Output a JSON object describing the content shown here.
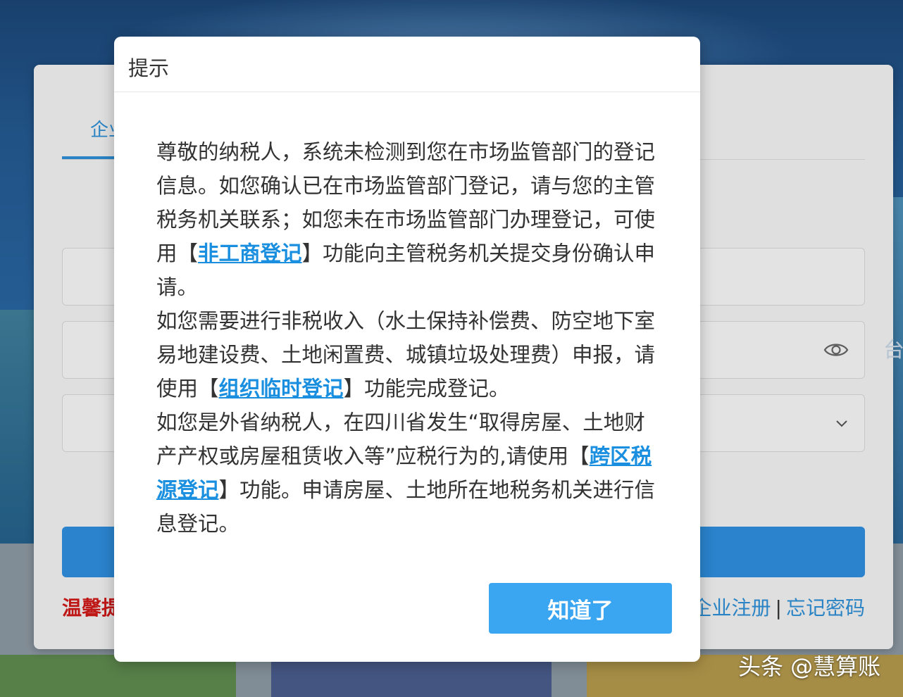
{
  "background": {
    "tab_label_fragment": "企业",
    "warm_tip_label": "温馨提",
    "links": [
      "企业注册",
      "忘记密码"
    ],
    "link_separator": "|",
    "edge_fragment": "台",
    "icons": {
      "password_toggle": "eye-icon",
      "select_arrow": "chevron-down-icon"
    },
    "colors": {
      "accent": "#2e8fde",
      "tip": "#d01818"
    }
  },
  "dialog": {
    "title": "提示",
    "p1": {
      "before": "尊敬的纳税人，系统未检测到您在市场监管部门的登记信息。如您确认已在市场监管部门登记，请与您的主管税务机关联系；如您未在市场监管部门办理登记，可使用【",
      "link": "非工商登记",
      "after": "】功能向主管税务机关提交身份确认申请。"
    },
    "p2": {
      "before": "如您需要进行非税收入（水土保持补偿费、防空地下室易地建设费、土地闲置费、城镇垃圾处理费）申报，请使用【",
      "link": "组织临时登记",
      "after": "】功能完成登记。"
    },
    "p3": {
      "before": "如您是外省纳税人，在四川省发生“取得房屋、土地财产产权或房屋租赁收入等”应税行为的,请使用【",
      "link": "跨区税源登记",
      "after": "】功能。申请房屋、土地所在地税务机关进行信息登记。"
    },
    "button": "知道了",
    "colors": {
      "link": "#1a8fe0",
      "button": "#3aa5f0"
    }
  },
  "watermark": "头条 @慧算账"
}
